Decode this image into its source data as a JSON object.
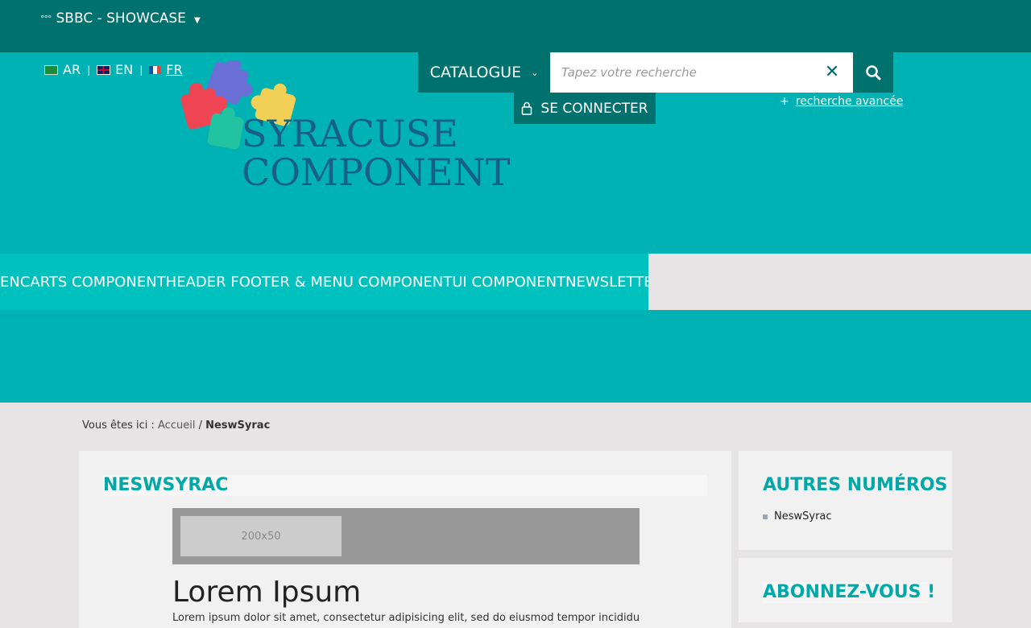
{
  "topbar": {
    "brand": "SBBC - SHOWCASE"
  },
  "languages": [
    {
      "code": "AR",
      "flag": "flag-sa-icon"
    },
    {
      "code": "EN",
      "flag": "flag-gb-icon"
    },
    {
      "code": "FR",
      "flag": "flag-fr-icon"
    }
  ],
  "logo": {
    "line1": "SYRACUSE",
    "line2": "COMPONENT"
  },
  "search": {
    "catalogue_label": "CATALOGUE",
    "placeholder": "Tapez votre recherche",
    "advanced_plus": "+",
    "advanced_label": "recherche avancée"
  },
  "login": {
    "label": "SE CONNECTER"
  },
  "nav": {
    "items": [
      "ENCARTS COMPONENT",
      "HEADER FOOTER & MENU COMPONENT",
      "UI COMPONENT",
      "NEWSLETTER"
    ]
  },
  "breadcrumb": {
    "prefix": "Vous êtes ici :",
    "home": "Accueil",
    "separator": "/",
    "current": "NeswSyrac"
  },
  "main": {
    "title": "NESWSYRAC",
    "banner_placeholder": "200x50",
    "article_title": "Lorem Ipsum",
    "article_text": "Lorem ipsum dolor sit amet, consectetur adipisicing elit, sed do eiusmod tempor incididunt ut"
  },
  "sidebar": {
    "other_issues_title": "AUTRES NUMÉROS",
    "other_issues": [
      "NeswSyrac"
    ],
    "subscribe_title": "ABONNEZ-VOUS !"
  },
  "colors": {
    "dark_teal": "#00716d",
    "teal": "#00b2b3",
    "nav_teal": "#00c1be",
    "title_teal": "#00a8a8",
    "logo_text": "#166088"
  }
}
